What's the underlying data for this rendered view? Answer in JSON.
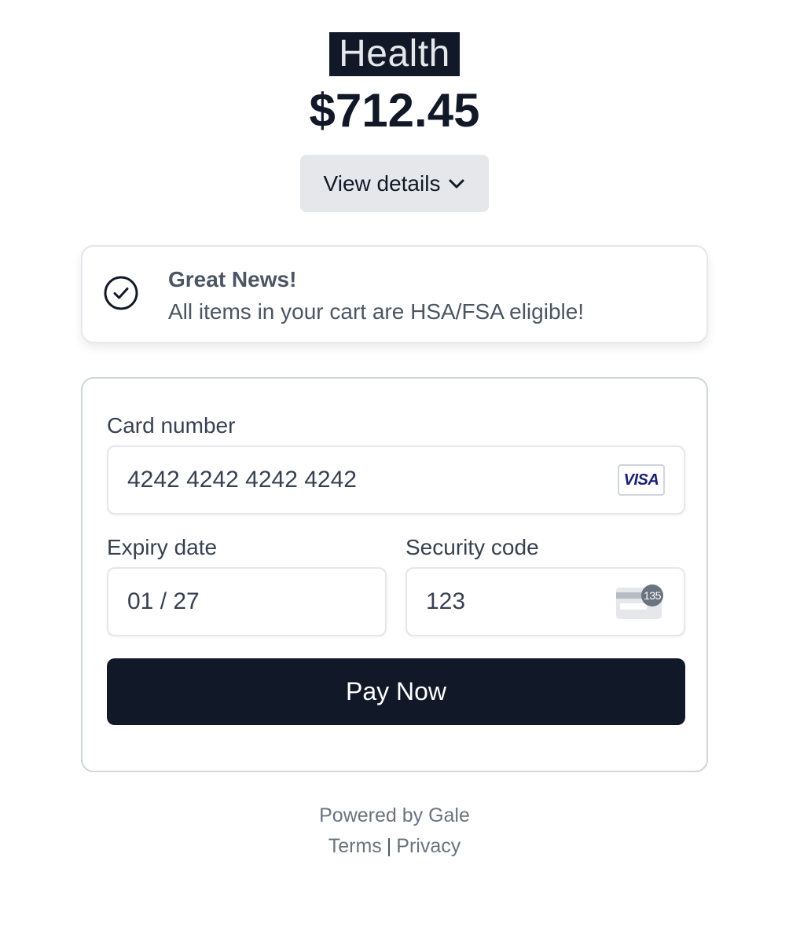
{
  "header": {
    "merchant_name": "Health",
    "amount": "$712.45",
    "details_button_label": "View details",
    "details_icon": "chevron-down-icon"
  },
  "notice": {
    "icon": "check-circle-icon",
    "title": "Great News!",
    "message": "All items in your cart are HSA/FSA eligible!"
  },
  "payment": {
    "card_number_label": "Card number",
    "card_number_value": "4242 4242 4242 4242",
    "card_brand": "VISA",
    "expiry_label": "Expiry date",
    "expiry_value": "01 / 27",
    "security_label": "Security code",
    "security_value": "123",
    "cvc_hint": "135",
    "pay_button_label": "Pay Now"
  },
  "footer": {
    "powered_by": "Powered by Gale",
    "terms": "Terms",
    "separator": "|",
    "privacy": "Privacy"
  },
  "colors": {
    "primary": "#111827",
    "muted_text": "#6b7280",
    "button_secondary_bg": "#e5e7eb",
    "visa_blue": "#1a1f71"
  }
}
